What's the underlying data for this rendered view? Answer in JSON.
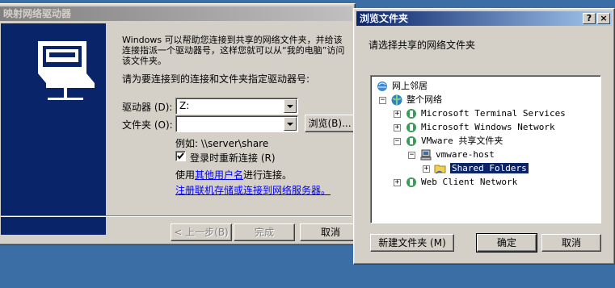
{
  "map_drive": {
    "title": "映射网络驱动器",
    "description": "Windows 可以帮助您连接到共享的网络文件夹，并给该连接指派一个驱动器号，这样您就可以从“我的电脑”访问该文件夹。",
    "prompt": "请为要连接到的连接和文件夹指定驱动器号:",
    "drive_label": "驱动器 (D):",
    "drive_value": "Z:",
    "folder_label": "文件夹 (O):",
    "folder_value": "",
    "browse_label": "浏览(B)...",
    "example": "例如: \\\\server\\share",
    "reconnect_label": "登录时重新连接 (R)",
    "reconnect_checked": true,
    "other_user_prefix": "使用",
    "other_user_link": "其他用户名",
    "other_user_suffix": "进行连接。",
    "storage_link": "注册联机存储或连接到网络服务器。",
    "back_label": "< 上一步(B)",
    "finish_label": "完成",
    "cancel_label": "取消"
  },
  "browse_dialog": {
    "title": "浏览文件夹",
    "help_btn": "?",
    "close_btn": "×",
    "instruction": "请选择共享的网络文件夹",
    "tree": [
      {
        "label": "网上邻居",
        "icon": "network-neighborhood-icon",
        "expander": ""
      },
      {
        "label": "整个网络",
        "icon": "entire-network-icon",
        "expander": "−"
      },
      {
        "label": "Microsoft Terminal Services",
        "icon": "network-provider-icon",
        "expander": "+"
      },
      {
        "label": "Microsoft Windows Network",
        "icon": "network-provider-icon",
        "expander": "+"
      },
      {
        "label": "VMware 共享文件夹",
        "icon": "network-provider-icon",
        "expander": "−"
      },
      {
        "label": "vmware-host",
        "icon": "computer-icon",
        "expander": "−"
      },
      {
        "label": "Shared Folders",
        "icon": "shared-folder-icon",
        "expander": "+",
        "selected": true
      },
      {
        "label": "Web Client Network",
        "icon": "network-provider-icon",
        "expander": "+"
      }
    ],
    "new_folder_label": "新建文件夹 (M)",
    "ok_label": "确定",
    "cancel_label": "取消"
  },
  "colors": {
    "active_title": "#0a246a",
    "desktop": "#3a6ea5",
    "face": "#d4d0c8"
  }
}
